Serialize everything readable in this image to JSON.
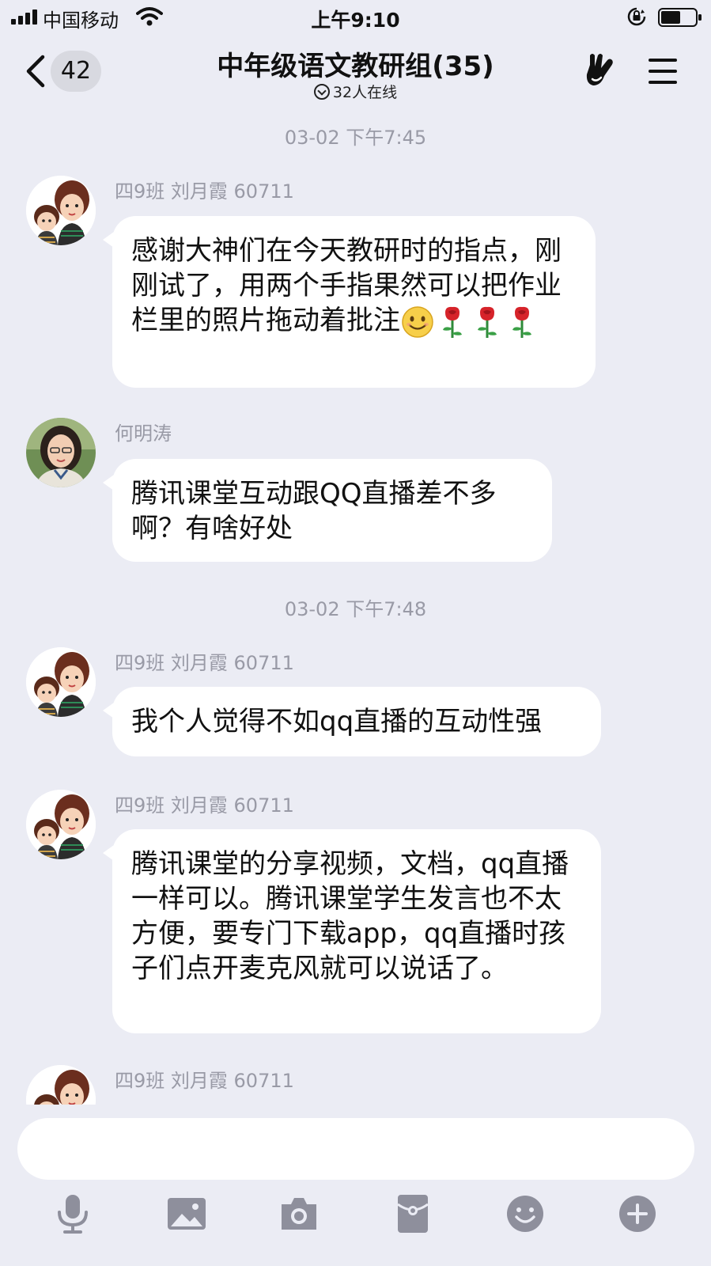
{
  "status_bar": {
    "carrier": "中国移动",
    "time": "上午9:10"
  },
  "header": {
    "back_count": "42",
    "title": "中年级语文教研组(35)",
    "online_text": "32人在线"
  },
  "chat": {
    "items": [
      {
        "type": "time",
        "text": "03-02 下午7:45"
      },
      {
        "type": "message",
        "sender": "四9班 刘月霞 60711",
        "text": "感谢大神们在今天教研时的指点，刚刚试了，用两个手指果然可以把作业栏里的照片拖动着批注"
      },
      {
        "type": "message",
        "sender": "何明涛",
        "text": "腾讯课堂互动跟QQ直播差不多啊？有啥好处"
      },
      {
        "type": "time",
        "text": "03-02 下午7:48"
      },
      {
        "type": "message",
        "sender": "四9班 刘月霞 60711",
        "text": "我个人觉得不如qq直播的互动性强"
      },
      {
        "type": "message",
        "sender": "四9班 刘月霞 60711",
        "text": "腾讯课堂的分享视频，文档，qq直播一样可以。腾讯课堂学生发言也不太方便，要专门下载app，qq直播时孩子们点开麦克风就可以说话了。"
      },
      {
        "type": "message",
        "sender": "四9班 刘月霞 60711",
        "text": ""
      }
    ]
  },
  "input": {
    "value": "",
    "placeholder": ""
  },
  "toolbar": [
    "microphone-icon",
    "image-icon",
    "camera-icon",
    "red-packet-icon",
    "emoji-icon",
    "plus-icon"
  ],
  "colors": {
    "background": "#ebecf4",
    "bubble": "#ffffff",
    "meta_text": "#999aa6",
    "toolbar_icon": "#8e8f9c"
  }
}
